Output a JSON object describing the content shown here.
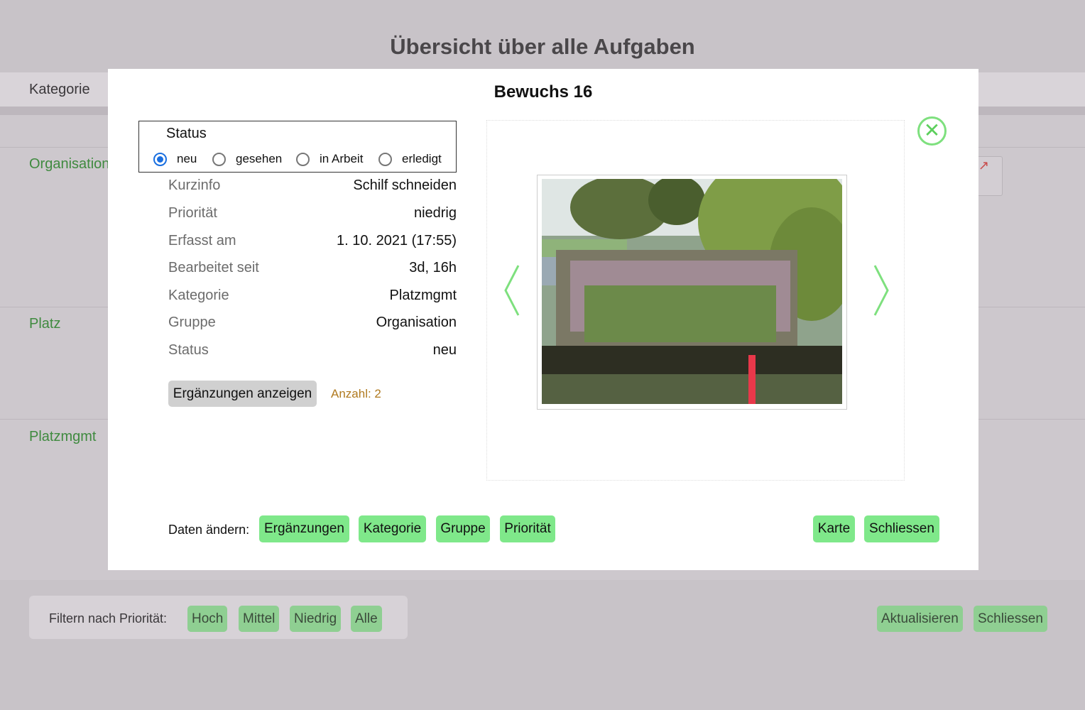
{
  "page": {
    "title": "Übersicht über alle Aufgaben"
  },
  "table": {
    "header": "Kategorie",
    "groups": [
      "Organisation",
      "Platz",
      "Platzmgmt"
    ]
  },
  "filter": {
    "label": "Filtern nach Priorität:",
    "buttons": [
      "Hoch",
      "Mittel",
      "Niedrig",
      "Alle"
    ]
  },
  "footer": {
    "refresh": "Aktualisieren",
    "close": "Schliessen"
  },
  "modal": {
    "title": "Bewuchs 16",
    "status": {
      "legend": "Status",
      "options": [
        "neu",
        "gesehen",
        "in Arbeit",
        "erledigt"
      ],
      "selected": "neu"
    },
    "details": [
      {
        "label": "Kurzinfo",
        "value": "Schilf schneiden"
      },
      {
        "label": "Priorität",
        "value": "niedrig"
      },
      {
        "label": "Erfasst am",
        "value": "1. 10. 2021 (17:55)"
      },
      {
        "label": "Bearbeitet seit",
        "value": "3d, 16h"
      },
      {
        "label": "Kategorie",
        "value": "Platzmgmt"
      },
      {
        "label": "Gruppe",
        "value": "Organisation"
      },
      {
        "label": "Status",
        "value": "neu"
      }
    ],
    "supplements_button": "Ergänzungen anzeigen",
    "supplements_count": "Anzahl: 2",
    "edit_label": "Daten ändern:",
    "edit_buttons": [
      "Ergänzungen",
      "Kategorie",
      "Gruppe",
      "Priorität"
    ],
    "map_button": "Karte",
    "close_button": "Schliessen",
    "prev_icon": "chevron-left-icon",
    "next_icon": "chevron-right-icon",
    "close_icon": "close-circle-icon",
    "accent_color": "#7fe88a"
  }
}
